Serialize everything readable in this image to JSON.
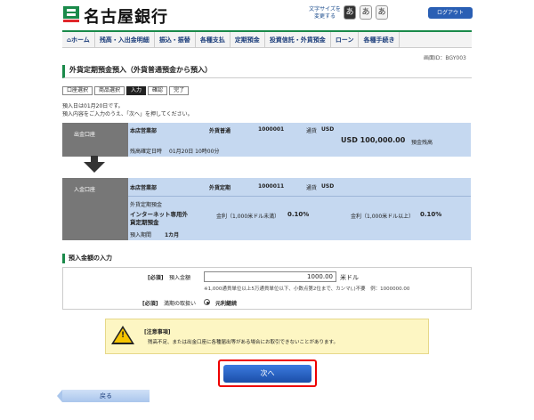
{
  "header": {
    "bank_name": "名古屋銀行",
    "font_size_label": "文字サイズを変更する",
    "font_small": "あ",
    "font_medium": "あ",
    "font_large": "あ",
    "logout": "ログアウト"
  },
  "nav": [
    "ホーム",
    "残高・入出金明細",
    "振込・振替",
    "各種支払",
    "定期預金",
    "投資信託・外貨預金",
    "ローン",
    "各種手続き"
  ],
  "screen_id": "画面ID：BGY003",
  "page_title": "外貨定期預金預入（外貨普通預金から預入）",
  "steps": [
    "口座選択",
    "商品選択",
    "入力",
    "確認",
    "完了"
  ],
  "intro": [
    "預入日は01月20日です。",
    "預入内容をご入力のうえ、「次へ」を押してください。"
  ],
  "withdraw": {
    "label": "出金口座",
    "branch": "本店営業部",
    "type": "外貨普通",
    "number": "1000001",
    "currency_label": "通貨",
    "currency": "USD",
    "balance": "USD 100,000.00",
    "balance_label": "預金残高",
    "time_label": "残高確定日時",
    "time": "01月20日 10時00分"
  },
  "deposit": {
    "label": "入金口座",
    "branch": "本店営業部",
    "type": "外貨定期",
    "number": "1000011",
    "currency_label": "通貨",
    "currency": "USD",
    "product_type": "外貨定期預金",
    "product": "インターネット専用外貨定期預金",
    "rate1_label": "金利（1,000米ドル未満）",
    "rate1": "0.10%",
    "rate2_label": "金利（1,000米ドル以上）",
    "rate2": "0.10%",
    "term_label": "預入期間",
    "term": "1カ月"
  },
  "form": {
    "section": "預入金額の入力",
    "required": "[必須]",
    "amount_label": "預入金額",
    "amount": "1000.00",
    "unit": "米ドル",
    "amount_note": "※1,000通貨単位以上5万通貨単位以下、小数点第2位まで、カンマ(,)不要　例：1000000.00",
    "maturity_label": "満期の取扱い",
    "maturity_option": "元利継続"
  },
  "notice": {
    "title": "[注意事項]",
    "text": "残高不足、または出金口座に各種届出等がある場合にお取引できないことがあります。"
  },
  "buttons": {
    "next": "次へ",
    "back": "戻る"
  }
}
